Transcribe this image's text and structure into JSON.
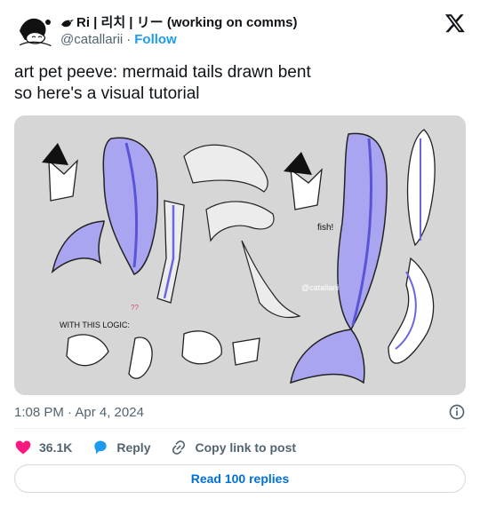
{
  "author": {
    "display_name": "Ri | 리치 | リー (working on comms)",
    "handle": "@catallarii",
    "separator": "·",
    "follow_label": "Follow",
    "avatar_icon": "sleeping-character-avatar",
    "name_prefix_icon": "black-bird-icon"
  },
  "tweet": {
    "lines": [
      "art pet peeve: mermaid tails drawn bent",
      "so here's a visual tutorial"
    ],
    "media_watermark": "@catallarii",
    "media_notes": [
      "fish!",
      "WITH THIS LOGIC:",
      "??"
    ]
  },
  "meta": {
    "timestamp": "1:08 PM · Apr 4, 2024",
    "info_icon": "info-icon"
  },
  "actions": {
    "likes": "36.1K",
    "reply_label": "Reply",
    "copy_label": "Copy link to post"
  },
  "read_replies_label": "Read 100 replies",
  "colors": {
    "accent": "#1d9bf0",
    "like": "#f91880",
    "text": "#0f1419",
    "muted": "#536471"
  }
}
